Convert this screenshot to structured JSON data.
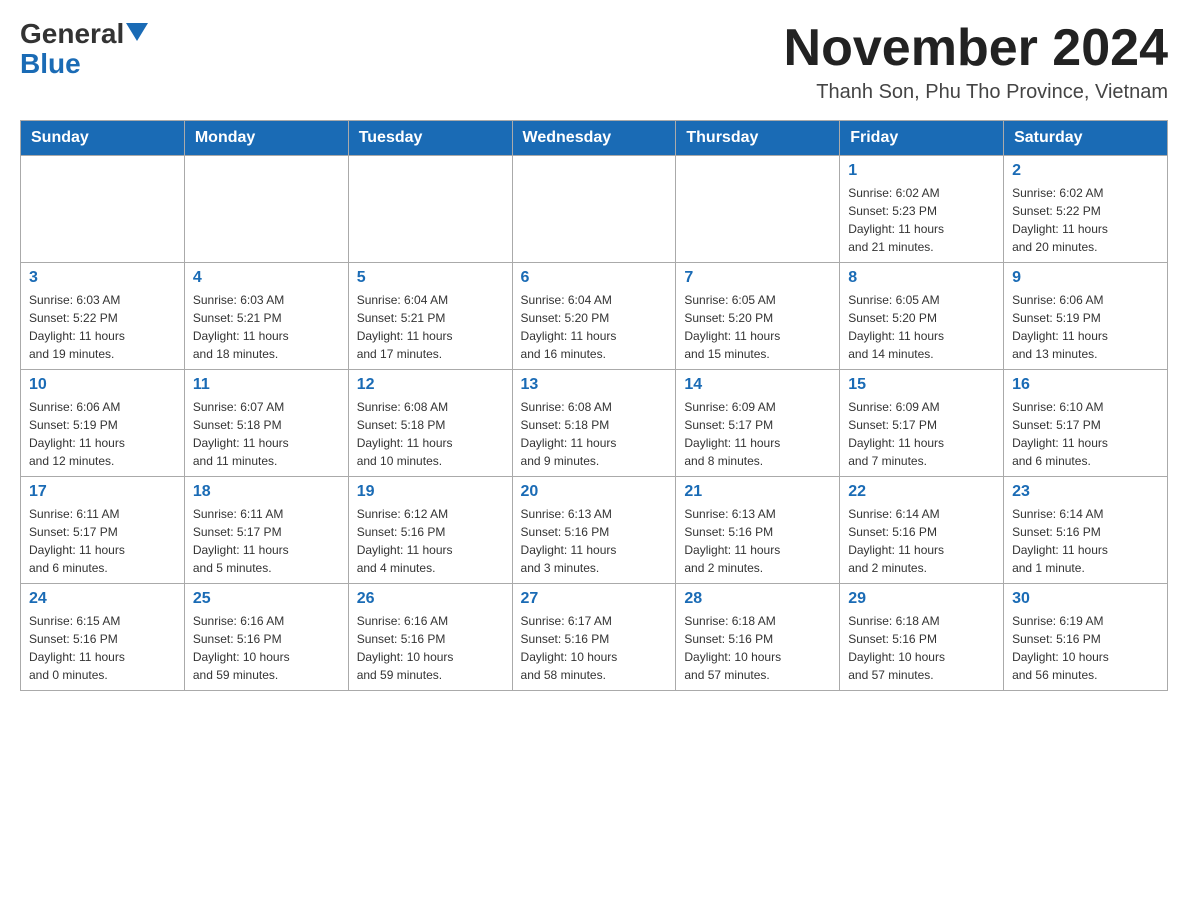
{
  "header": {
    "logo_general": "General",
    "logo_blue": "Blue",
    "month_title": "November 2024",
    "location": "Thanh Son, Phu Tho Province, Vietnam"
  },
  "days_of_week": [
    "Sunday",
    "Monday",
    "Tuesday",
    "Wednesday",
    "Thursday",
    "Friday",
    "Saturday"
  ],
  "weeks": [
    [
      {
        "day": "",
        "info": ""
      },
      {
        "day": "",
        "info": ""
      },
      {
        "day": "",
        "info": ""
      },
      {
        "day": "",
        "info": ""
      },
      {
        "day": "",
        "info": ""
      },
      {
        "day": "1",
        "info": "Sunrise: 6:02 AM\nSunset: 5:23 PM\nDaylight: 11 hours\nand 21 minutes."
      },
      {
        "day": "2",
        "info": "Sunrise: 6:02 AM\nSunset: 5:22 PM\nDaylight: 11 hours\nand 20 minutes."
      }
    ],
    [
      {
        "day": "3",
        "info": "Sunrise: 6:03 AM\nSunset: 5:22 PM\nDaylight: 11 hours\nand 19 minutes."
      },
      {
        "day": "4",
        "info": "Sunrise: 6:03 AM\nSunset: 5:21 PM\nDaylight: 11 hours\nand 18 minutes."
      },
      {
        "day": "5",
        "info": "Sunrise: 6:04 AM\nSunset: 5:21 PM\nDaylight: 11 hours\nand 17 minutes."
      },
      {
        "day": "6",
        "info": "Sunrise: 6:04 AM\nSunset: 5:20 PM\nDaylight: 11 hours\nand 16 minutes."
      },
      {
        "day": "7",
        "info": "Sunrise: 6:05 AM\nSunset: 5:20 PM\nDaylight: 11 hours\nand 15 minutes."
      },
      {
        "day": "8",
        "info": "Sunrise: 6:05 AM\nSunset: 5:20 PM\nDaylight: 11 hours\nand 14 minutes."
      },
      {
        "day": "9",
        "info": "Sunrise: 6:06 AM\nSunset: 5:19 PM\nDaylight: 11 hours\nand 13 minutes."
      }
    ],
    [
      {
        "day": "10",
        "info": "Sunrise: 6:06 AM\nSunset: 5:19 PM\nDaylight: 11 hours\nand 12 minutes."
      },
      {
        "day": "11",
        "info": "Sunrise: 6:07 AM\nSunset: 5:18 PM\nDaylight: 11 hours\nand 11 minutes."
      },
      {
        "day": "12",
        "info": "Sunrise: 6:08 AM\nSunset: 5:18 PM\nDaylight: 11 hours\nand 10 minutes."
      },
      {
        "day": "13",
        "info": "Sunrise: 6:08 AM\nSunset: 5:18 PM\nDaylight: 11 hours\nand 9 minutes."
      },
      {
        "day": "14",
        "info": "Sunrise: 6:09 AM\nSunset: 5:17 PM\nDaylight: 11 hours\nand 8 minutes."
      },
      {
        "day": "15",
        "info": "Sunrise: 6:09 AM\nSunset: 5:17 PM\nDaylight: 11 hours\nand 7 minutes."
      },
      {
        "day": "16",
        "info": "Sunrise: 6:10 AM\nSunset: 5:17 PM\nDaylight: 11 hours\nand 6 minutes."
      }
    ],
    [
      {
        "day": "17",
        "info": "Sunrise: 6:11 AM\nSunset: 5:17 PM\nDaylight: 11 hours\nand 6 minutes."
      },
      {
        "day": "18",
        "info": "Sunrise: 6:11 AM\nSunset: 5:17 PM\nDaylight: 11 hours\nand 5 minutes."
      },
      {
        "day": "19",
        "info": "Sunrise: 6:12 AM\nSunset: 5:16 PM\nDaylight: 11 hours\nand 4 minutes."
      },
      {
        "day": "20",
        "info": "Sunrise: 6:13 AM\nSunset: 5:16 PM\nDaylight: 11 hours\nand 3 minutes."
      },
      {
        "day": "21",
        "info": "Sunrise: 6:13 AM\nSunset: 5:16 PM\nDaylight: 11 hours\nand 2 minutes."
      },
      {
        "day": "22",
        "info": "Sunrise: 6:14 AM\nSunset: 5:16 PM\nDaylight: 11 hours\nand 2 minutes."
      },
      {
        "day": "23",
        "info": "Sunrise: 6:14 AM\nSunset: 5:16 PM\nDaylight: 11 hours\nand 1 minute."
      }
    ],
    [
      {
        "day": "24",
        "info": "Sunrise: 6:15 AM\nSunset: 5:16 PM\nDaylight: 11 hours\nand 0 minutes."
      },
      {
        "day": "25",
        "info": "Sunrise: 6:16 AM\nSunset: 5:16 PM\nDaylight: 10 hours\nand 59 minutes."
      },
      {
        "day": "26",
        "info": "Sunrise: 6:16 AM\nSunset: 5:16 PM\nDaylight: 10 hours\nand 59 minutes."
      },
      {
        "day": "27",
        "info": "Sunrise: 6:17 AM\nSunset: 5:16 PM\nDaylight: 10 hours\nand 58 minutes."
      },
      {
        "day": "28",
        "info": "Sunrise: 6:18 AM\nSunset: 5:16 PM\nDaylight: 10 hours\nand 57 minutes."
      },
      {
        "day": "29",
        "info": "Sunrise: 6:18 AM\nSunset: 5:16 PM\nDaylight: 10 hours\nand 57 minutes."
      },
      {
        "day": "30",
        "info": "Sunrise: 6:19 AM\nSunset: 5:16 PM\nDaylight: 10 hours\nand 56 minutes."
      }
    ]
  ]
}
